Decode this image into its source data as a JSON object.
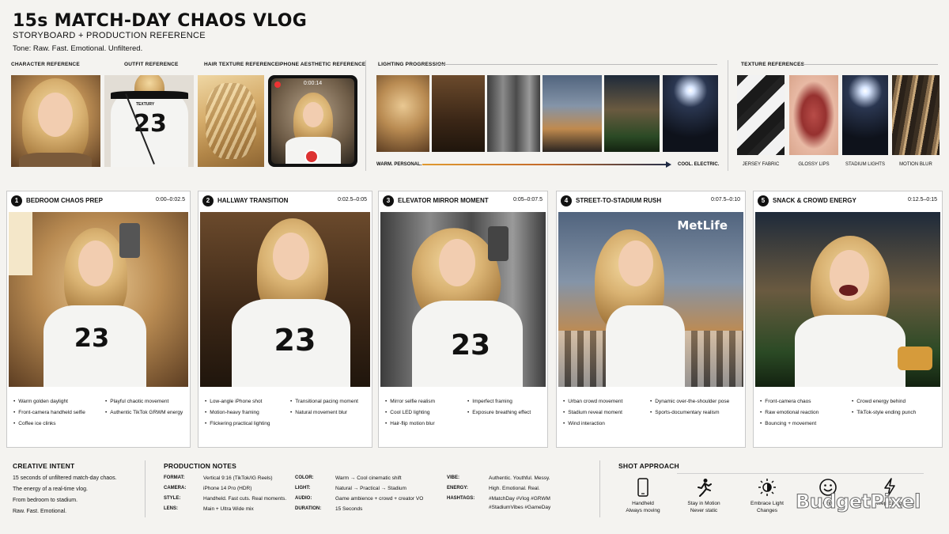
{
  "header": {
    "title": "15s MATCH-DAY CHAOS VLOG",
    "subtitle": "STORYBOARD + PRODUCTION REFERENCE",
    "tone": "Tone: Raw. Fast. Emotional. Unfiltered."
  },
  "references": {
    "character": "CHARACTER REFERENCE",
    "outfit": "OUTFIT REFERENCE",
    "hair": "HAIR TEXTURE REFERENCE",
    "iphone": "IPHONE AESTHETIC REFERENCE",
    "iphone_timer": "0:00:14",
    "jersey_number": "23",
    "jersey_text": "TEXTURY",
    "lighting": "LIGHTING PROGRESSION",
    "warm": "WARM. PERSONAL.",
    "cool": "COOL. ELECTRIC.",
    "textures_title": "TEXTURE REFERENCES",
    "textures": [
      "JERSEY FABRIC",
      "GLOSSY LIPS",
      "STADIUM LIGHTS",
      "MOTION BLUR"
    ]
  },
  "scenes": [
    {
      "num": "1",
      "title": "BEDROOM CHAOS PREP",
      "time": "0:00–0:02.5",
      "col1": [
        "Warm golden daylight",
        "Front-camera handheld selfie",
        "Coffee ice clinks"
      ],
      "col2": [
        "Playful chaotic movement",
        "Authentic TikTok GRWM energy"
      ]
    },
    {
      "num": "2",
      "title": "HALLWAY TRANSITION",
      "time": "0:02.5–0:05",
      "col1": [
        "Low-angle iPhone shot",
        "Motion-heavy framing",
        "Flickering practical lighting"
      ],
      "col2": [
        "Transitional pacing moment",
        "Natural movement blur"
      ]
    },
    {
      "num": "3",
      "title": "ELEVATOR MIRROR MOMENT",
      "time": "0:05–0:07.5",
      "col1": [
        "Mirror selfie realism",
        "Cool LED lighting",
        "Hair-flip motion blur"
      ],
      "col2": [
        "Imperfect framing",
        "Exposure breathing effect"
      ]
    },
    {
      "num": "4",
      "title": "STREET-TO-STADIUM RUSH",
      "time": "0:07.5–0:10",
      "col1": [
        "Urban crowd movement",
        "Stadium reveal moment",
        "Wind interaction"
      ],
      "col2": [
        "Dynamic over-the-shoulder pose",
        "Sports-documentary realism"
      ]
    },
    {
      "num": "5",
      "title": "SNACK & CROWD ENERGY",
      "time": "0:12.5–0:15",
      "col1": [
        "Front-camera chaos",
        "Raw emotional reaction",
        "Bouncing + movement"
      ],
      "col2": [
        "Crowd energy behind",
        "TikTok-style ending punch"
      ]
    }
  ],
  "scene_signs": {
    "metlife": "MetLife",
    "jersey_number": "23",
    "jersey_text": "TEXTURY"
  },
  "intent": {
    "title": "CREATIVE INTENT",
    "lines": [
      "15 seconds of unfiltered match-day chaos.",
      "The energy of a real-time vlog.",
      "From bedroom to stadium.",
      "Raw. Fast. Emotional."
    ]
  },
  "production": {
    "title": "PRODUCTION NOTES",
    "format_k": "FORMAT:",
    "format_v": "Vertical 9:16 (TikTok/IG Reels)",
    "camera_k": "CAMERA:",
    "camera_v": "iPhone 14 Pro (HDR)",
    "style_k": "STYLE:",
    "style_v": "Handheld. Fast cuts. Real moments.",
    "lens_k": "LENS:",
    "lens_v": "Main + Ultra Wide mix",
    "color_k": "COLOR:",
    "color_v": "Warm → Cool cinematic shift",
    "light_k": "LIGHT:",
    "light_v": "Natural → Practical → Stadium",
    "audio_k": "AUDIO:",
    "audio_v": "Game ambience + crowd + creator VO",
    "duration_k": "DURATION:",
    "duration_v": "15 Seconds",
    "vibe_k": "VIBE:",
    "vibe_v": "Authentic. Youthful. Messy.",
    "energy_k": "ENERGY:",
    "energy_v": "High. Emotional. Real.",
    "hashtags_k": "HASHTAGS:",
    "hashtags_v1": "#MatchDay #Vlog #GRWM",
    "hashtags_v2": "#StadiumVibes #GameDay"
  },
  "shot": {
    "title": "SHOT APPROACH",
    "items": [
      {
        "icon": "phone-icon",
        "l1": "Handheld",
        "l2": "Always moving"
      },
      {
        "icon": "running-person-icon",
        "l1": "Stay in Motion",
        "l2": "Never static"
      },
      {
        "icon": "sun-half-icon",
        "l1": "Embrace Light",
        "l2": "Changes"
      },
      {
        "icon": "smiley-icon",
        "l1": "",
        "l2": "Only"
      },
      {
        "icon": "lightning-icon",
        "l1": "",
        "l2": "Keep Energy"
      }
    ]
  },
  "watermark": "BudgetPixel"
}
